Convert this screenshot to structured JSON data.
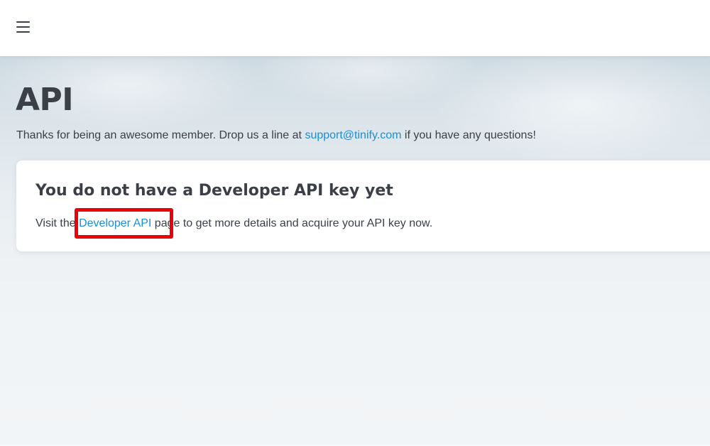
{
  "header": {
    "menu_icon": "hamburger-menu-icon"
  },
  "page": {
    "title": "API",
    "intro_before": "Thanks for being an awesome member. Drop us a line at ",
    "support_email": "support@tinify.com",
    "intro_after": " if you have any questions!"
  },
  "card": {
    "title": "You do not have a Developer API key yet",
    "text_before": "Visit the ",
    "link_label": "Developer API",
    "text_after": " page to get more details and acquire your API key now."
  },
  "colors": {
    "link": "#1a8fd6",
    "text": "#3b4048",
    "highlight": "#e8000b"
  }
}
